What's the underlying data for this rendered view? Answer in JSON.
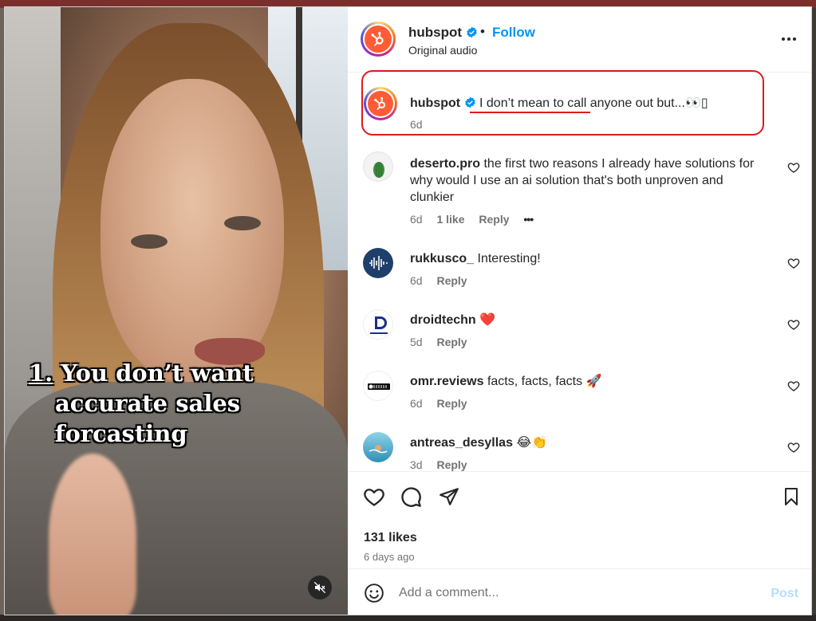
{
  "colors": {
    "accent": "#0095f6",
    "hubspot_orange": "#ff5c35",
    "annotation_red": "#e0191c",
    "meta_grey": "#737373"
  },
  "video": {
    "overlay_number": "1.",
    "overlay_line_1": "You don’t want",
    "overlay_line_2": "accurate sales",
    "overlay_line_3": "forcasting",
    "mute_icon": "speaker-muted-icon"
  },
  "header": {
    "username": "hubspot",
    "verified_icon": "verified-badge-icon",
    "separator": "•",
    "follow_label": "Follow",
    "subtitle": "Original audio",
    "more_icon": "more-horizontal-icon"
  },
  "caption": {
    "username": "hubspot",
    "text_part1": "I don’t mean to call",
    "text_part2": " anyone out but...👀",
    "trailing_glyph": "▯",
    "time": "6d"
  },
  "comments": [
    {
      "username": "deserto.pro",
      "text": "the first two reasons I already have solutions for why would I use an ai solution that's both unproven and clunkier",
      "time": "6d",
      "likes": "1 like",
      "reply": "Reply",
      "more": "•••"
    },
    {
      "username": "rukkusco_",
      "text": "Interesting!",
      "time": "6d",
      "reply": "Reply"
    },
    {
      "username": "droidtechn",
      "text": "❤️",
      "time": "5d",
      "reply": "Reply"
    },
    {
      "username": "omr.reviews",
      "text": "facts, facts, facts 🚀",
      "time": "6d",
      "reply": "Reply"
    },
    {
      "username": "antreas_desyllas",
      "text": "😂👏",
      "time": "3d",
      "reply": "Reply"
    }
  ],
  "actions": {
    "like_icon": "heart-icon",
    "comment_icon": "comment-bubble-icon",
    "share_icon": "paper-plane-icon",
    "save_icon": "bookmark-icon",
    "likes_count": "131 likes",
    "time_ago": "6 days ago"
  },
  "comment_box": {
    "placeholder": "Add a comment...",
    "post_label": "Post",
    "emoji_icon": "smiley-icon"
  }
}
